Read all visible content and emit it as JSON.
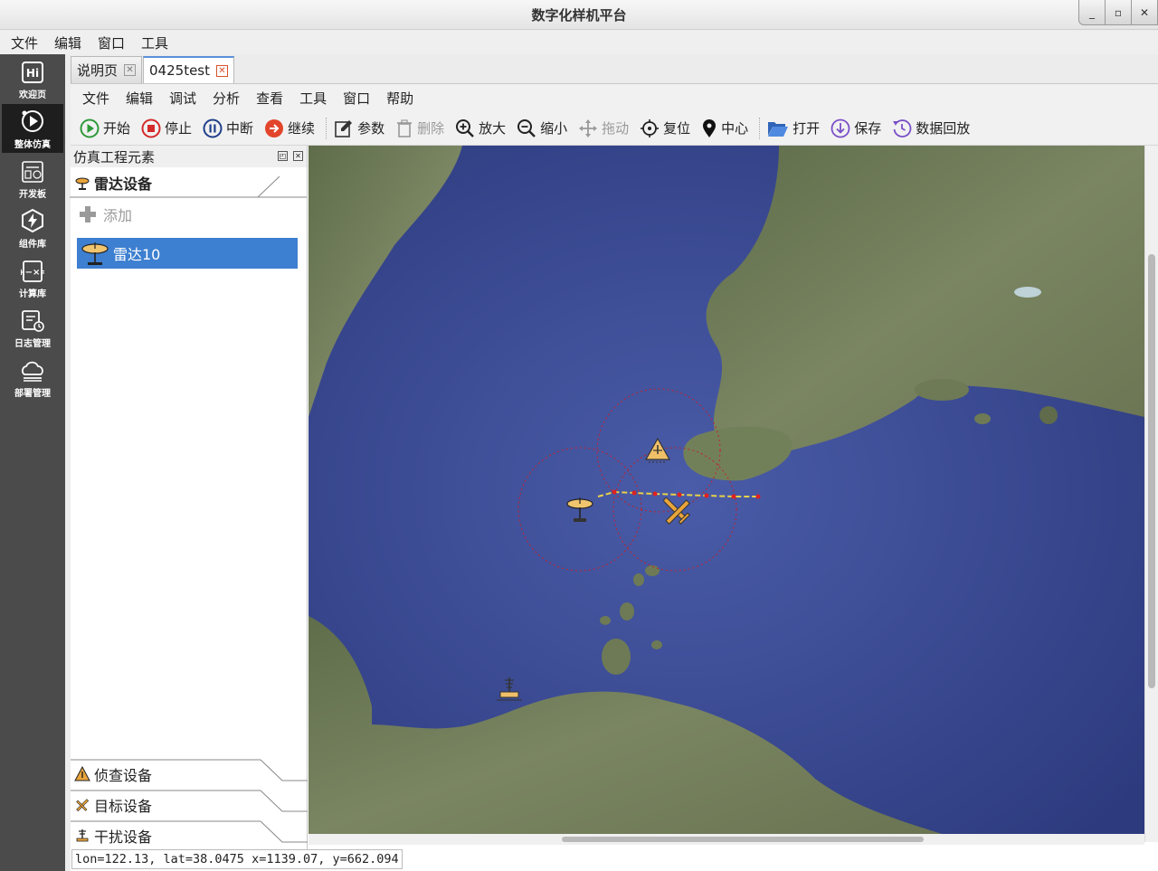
{
  "window": {
    "title": "数字化样机平台",
    "minimize": "_",
    "maximize": "▫",
    "close": "✕"
  },
  "app_menu": [
    "文件",
    "编辑",
    "窗口",
    "工具"
  ],
  "sidebar": {
    "items": [
      {
        "label": "欢迎页",
        "icon": "hi-icon",
        "active": false
      },
      {
        "label": "整体仿真",
        "icon": "simulation-play-icon",
        "active": true
      },
      {
        "label": "开发板",
        "icon": "devboard-icon",
        "active": false
      },
      {
        "label": "组件库",
        "icon": "lightning-icon",
        "active": false
      },
      {
        "label": "计算库",
        "icon": "calculator-icon",
        "active": false
      },
      {
        "label": "日志管理",
        "icon": "log-calendar-icon",
        "active": false
      },
      {
        "label": "部署管理",
        "icon": "cloud-icon",
        "active": false
      }
    ]
  },
  "doc_tabs": [
    {
      "label": "说明页",
      "active": false
    },
    {
      "label": "0425test",
      "active": true
    }
  ],
  "inner_menu": [
    "文件",
    "编辑",
    "调试",
    "分析",
    "查看",
    "工具",
    "窗口",
    "帮助"
  ],
  "toolbar": {
    "start": "开始",
    "stop": "停止",
    "pause": "中断",
    "resume": "继续",
    "params": "参数",
    "delete": "删除",
    "zoom_in": "放大",
    "zoom_out": "缩小",
    "pan": "拖动",
    "reset": "复位",
    "center": "中心",
    "open": "打开",
    "save": "保存",
    "replay": "数据回放"
  },
  "panel": {
    "title": "仿真工程元素",
    "radar_group": "雷达设备",
    "add_label": "添加",
    "selected_item": "雷达10",
    "recon_group": "侦查设备",
    "target_group": "目标设备",
    "jam_group": "干扰设备"
  },
  "status": {
    "coords": "lon=122.13, lat=38.0475 x=1139.07, y=662.094"
  },
  "colors": {
    "selection": "#3d7fd0",
    "sidebar": "#4b4b4b",
    "sea": "#3a4c96",
    "land": "#6e7a58",
    "track": "#e6d24a",
    "waypoint": "#e02020"
  }
}
